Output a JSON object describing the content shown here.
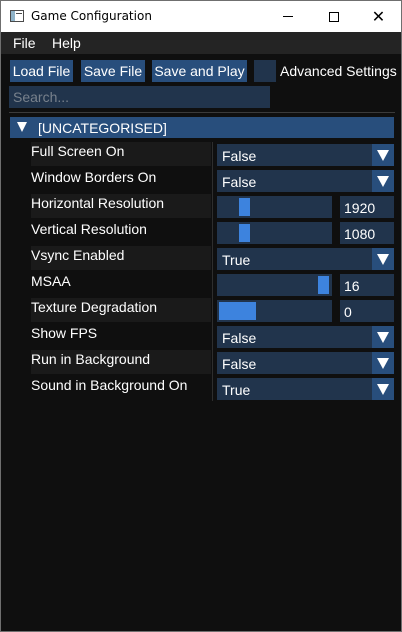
{
  "window": {
    "title": "Game Configuration",
    "controls": {
      "minimize": "minimize-icon",
      "maximize": "maximize-icon",
      "close": "close-icon",
      "close_glyph": "✕"
    }
  },
  "menu": {
    "file": "File",
    "help": "Help"
  },
  "toolbar": {
    "load": "Load File",
    "save": "Save File",
    "save_and_play": "Save and Play",
    "advanced_label": "Advanced Settings",
    "advanced_checked": false
  },
  "search": {
    "placeholder": "Search...",
    "value": ""
  },
  "category": {
    "label": "[UNCATEGORISED]",
    "expanded": true
  },
  "settings": [
    {
      "label": "Full Screen On",
      "type": "combo",
      "value": "False"
    },
    {
      "label": "Window Borders On",
      "type": "combo",
      "value": "False"
    },
    {
      "label": "Horizontal Resolution",
      "type": "slider",
      "value": "1920"
    },
    {
      "label": "Vertical Resolution",
      "type": "slider",
      "value": "1080"
    },
    {
      "label": "Vsync Enabled",
      "type": "combo",
      "value": "True"
    },
    {
      "label": "MSAA",
      "type": "slider",
      "value": "16"
    },
    {
      "label": "Texture Degradation",
      "type": "slider",
      "value": "0"
    },
    {
      "label": "Show FPS",
      "type": "combo",
      "value": "False"
    },
    {
      "label": "Run in Background",
      "type": "combo",
      "value": "False"
    },
    {
      "label": "Sound in Background On",
      "type": "combo",
      "value": "True"
    }
  ],
  "colors": {
    "accent": "#284e7c",
    "field": "#21344c",
    "slider_grab": "#3d83de",
    "background": "#0f0f0f"
  }
}
